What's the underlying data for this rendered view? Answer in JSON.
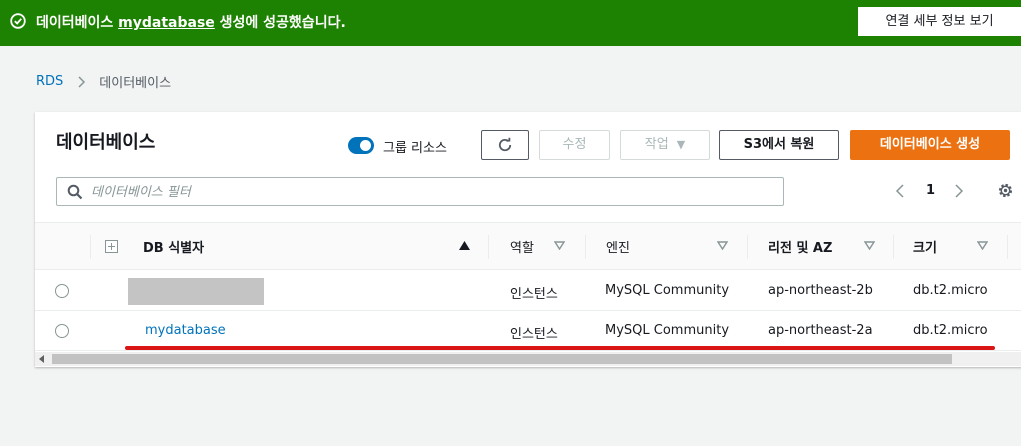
{
  "banner": {
    "message_prefix": "데이터베이스 ",
    "db_link": "mydatabase",
    "message_suffix": " 생성에 성공했습니다.",
    "view_details_label": "연결 세부 정보 보기"
  },
  "breadcrumb": {
    "root": "RDS",
    "current": "데이터베이스"
  },
  "panel": {
    "title": "데이터베이스",
    "group_toggle_label": "그룹 리소스",
    "modify_label": "수정",
    "actions_label": "작업",
    "restore_s3_label": "S3에서 복원",
    "create_label": "데이터베이스 생성",
    "search_placeholder": "데이터베이스 필터",
    "page_number": "1"
  },
  "table": {
    "columns": [
      "DB 식별자",
      "역할",
      "엔진",
      "리전 및 AZ",
      "크기"
    ],
    "rows": [
      {
        "identifier": "",
        "role": "인스턴스",
        "engine": "MySQL Community",
        "region": "ap-northeast-2b",
        "size": "db.t2.micro"
      },
      {
        "identifier": "mydatabase",
        "role": "인스턴스",
        "engine": "MySQL Community",
        "region": "ap-northeast-2a",
        "size": "db.t2.micro"
      }
    ]
  },
  "icons": {
    "success": "check-circle-icon",
    "refresh": "refresh-icon",
    "search": "search-icon",
    "settings": "gear-icon",
    "expand": "expand-icon"
  },
  "colors": {
    "success_banner": "#1d8102",
    "primary": "#ec7211",
    "link": "#0073bb",
    "highlight_underline": "#d91515"
  }
}
